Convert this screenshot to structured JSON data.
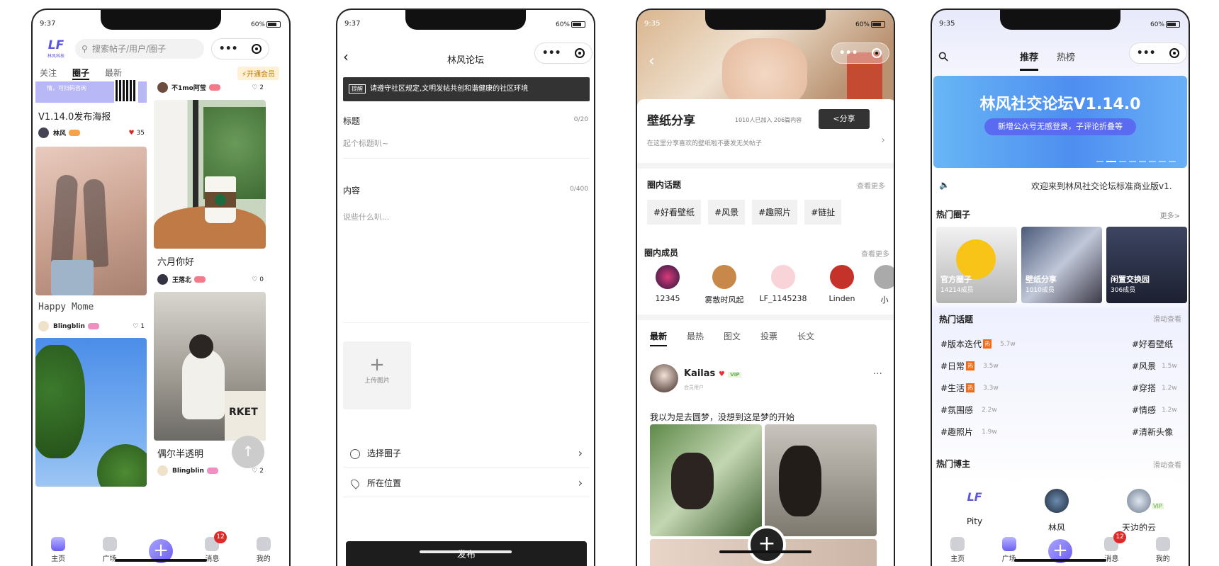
{
  "status_a": {
    "time": "9:37",
    "battery": "60%"
  },
  "status_b": {
    "time": "9:35",
    "battery": "60%"
  },
  "tabbar": {
    "home": "主页",
    "square": "广场",
    "messages": "消息",
    "mine": "我的",
    "badge": "12"
  },
  "screen1": {
    "logo": "LF",
    "logo_sub": "林风科技",
    "search_placeholder": "搜索帖子/用户/圈子",
    "tabs": [
      "关注",
      "圈子",
      "最新"
    ],
    "vip": "开通会员",
    "banner_text": "情，可扫码咨询",
    "posts": [
      {
        "title": "V1.14.0发布海报",
        "user": "林风",
        "likes": "35"
      },
      {
        "title": "Happy Mome",
        "user": "Blingblin",
        "likes": "1"
      },
      {
        "user": "不1mo阿莹",
        "likes": "2"
      },
      {
        "title": "六月你好",
        "user": "王落北",
        "likes": "0"
      },
      {
        "title": "偶尔半透明",
        "user": "Blingblin",
        "likes": "2"
      }
    ],
    "photo_text": "RKET"
  },
  "screen2": {
    "title": "林风论坛",
    "notice_tag": "提醒",
    "notice": "请遵守社区规定,文明发帖共创和谐健康的社区环境",
    "field_title": "标题",
    "title_count": "0/20",
    "title_placeholder": "起个标题叭~",
    "field_content": "内容",
    "content_count": "0/400",
    "content_placeholder": "说些什么叭...",
    "upload": "上传图片",
    "choose_circle": "选择圈子",
    "location": "所在位置",
    "publish": "发布"
  },
  "screen3": {
    "name": "壁纸分享",
    "stats": "1010人已加入 206篇内容",
    "share": "<分享",
    "desc": "在这里分享喜欢的壁纸啦不要发无关帖子",
    "topics_title": "圈内话题",
    "see_more": "查看更多",
    "topics": [
      "#好看壁纸",
      "#风景",
      "#趣照片",
      "#链扯"
    ],
    "members_title": "圈内成员",
    "members": [
      "12345",
      "雾散时风起",
      "LF_1145238",
      "Linden",
      "小"
    ],
    "feed_tabs": [
      "最新",
      "最热",
      "图文",
      "投票",
      "长文"
    ],
    "post_user": "Kailas",
    "post_user_sub": "会员用户",
    "post_vip": "VIP",
    "post_text": "我以为是去圆梦，没想到这是梦的开始",
    "more": "···"
  },
  "screen4": {
    "tabs": [
      "推荐",
      "热榜"
    ],
    "banner_title": "林风社交论坛V1.14.0",
    "banner_sub": "新增公众号无感登录，子评论折叠等",
    "marquee": "欢迎来到林风社交论坛标准商业版v1.",
    "hot_circles": "热门圈子",
    "more": "更多>",
    "circles": [
      {
        "name": "官方圈子",
        "members": "14214成员"
      },
      {
        "name": "壁纸分享",
        "members": "1010成员"
      },
      {
        "name": "闲置交换园",
        "members": "306成员"
      }
    ],
    "hot_topics": "热门话题",
    "swipe": "滑动查看",
    "hot_tag": "热",
    "topics_left": [
      {
        "name": "#版本迭代",
        "count": "5.7w",
        "hot": true
      },
      {
        "name": "#日常",
        "count": "3.5w",
        "hot": true
      },
      {
        "name": "#生活",
        "count": "3.3w",
        "hot": true
      },
      {
        "name": "#氛围感",
        "count": "2.2w",
        "hot": false
      },
      {
        "name": "#趣照片",
        "count": "1.9w",
        "hot": false
      }
    ],
    "topics_right": [
      {
        "name": "#好看壁纸",
        "count": ""
      },
      {
        "name": "#风景",
        "count": "1.5w"
      },
      {
        "name": "#穿搭",
        "count": "1.2w"
      },
      {
        "name": "#情感",
        "count": "1.2w"
      },
      {
        "name": "#清新头像",
        "count": ""
      }
    ],
    "hot_bloggers": "热门博主",
    "bloggers": [
      "Pity",
      "林风",
      "天边的云"
    ],
    "vip": "VIP"
  }
}
